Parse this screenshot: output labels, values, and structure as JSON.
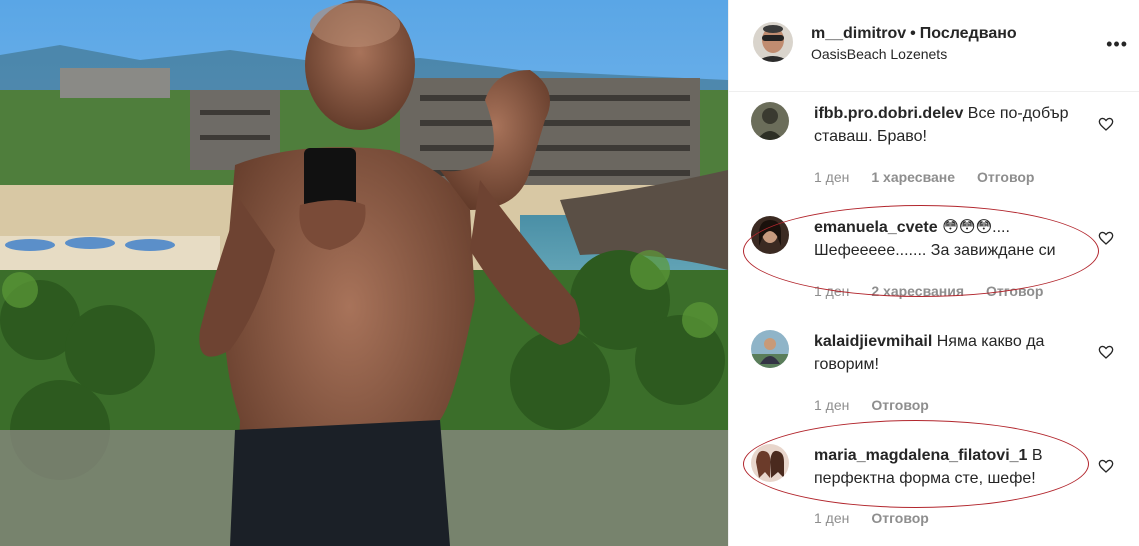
{
  "post": {
    "username": "m__dimitrov",
    "separator": "•",
    "follow_label": "Последвано",
    "location": "OasisBeach Lozenets",
    "more_label": "•••"
  },
  "comments": [
    {
      "username": "ifbb.pro.dobri.delev",
      "text": "Все по-добър ставаш. Браво!",
      "time": "1 ден",
      "likes": "1 харесване",
      "reply": "Отговор"
    },
    {
      "username": "emanuela_cvete",
      "text": "😳😳😳.... Шефеееее....... За завиждане си",
      "time": "1 ден",
      "likes": "2 харесвания",
      "reply": "Отговор"
    },
    {
      "username": "kalaidjievmihail",
      "text": "Няма какво да говорим!",
      "time": "1 ден",
      "likes": "",
      "reply": "Отговор"
    },
    {
      "username": "maria_magdalena_filatovi_1",
      "text": "В перфектна форма сте, шефе!",
      "time": "1 ден",
      "likes": "",
      "reply": "Отговор"
    }
  ],
  "colors": {
    "highlight": "#b2262d",
    "meta": "#8e8e8e"
  },
  "icons": [
    "more-options-icon",
    "heart-icon"
  ]
}
